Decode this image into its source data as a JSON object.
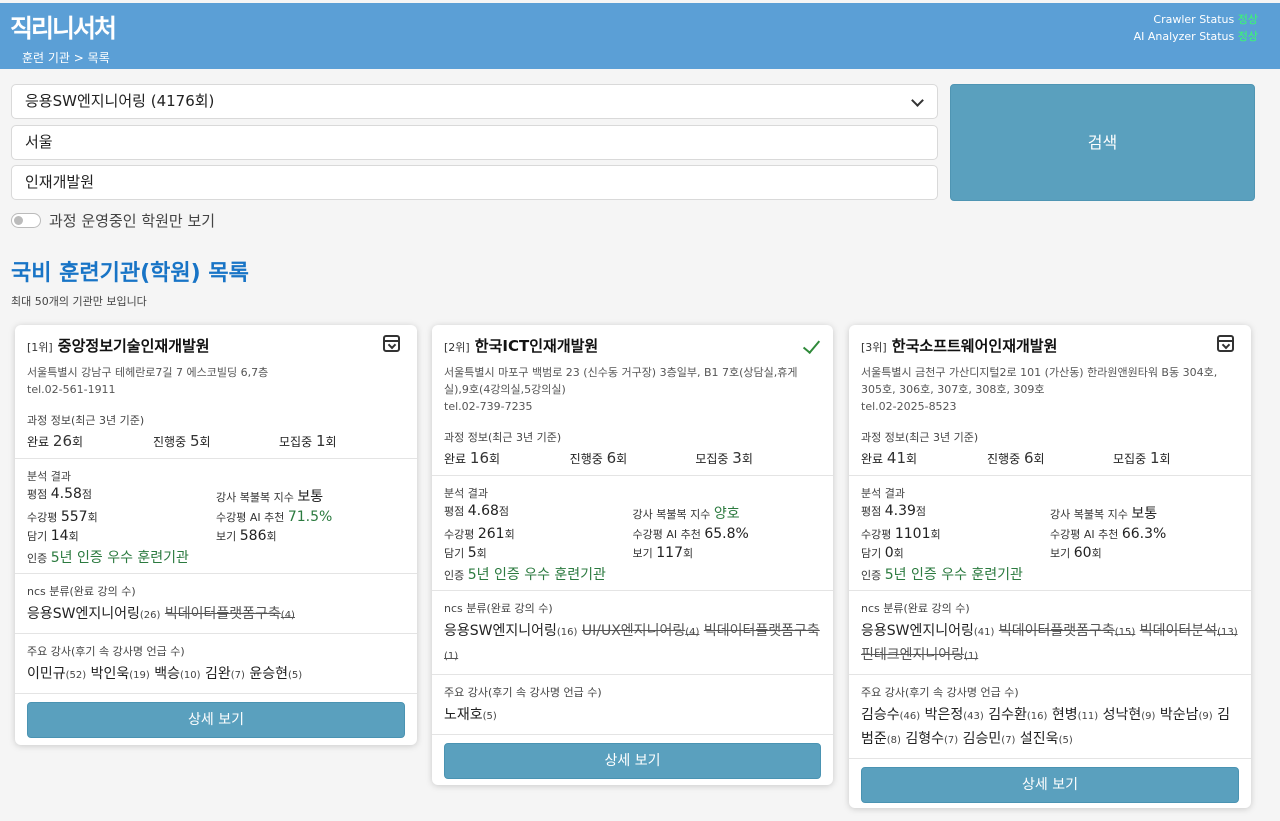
{
  "header": {
    "logo": "직리니서처",
    "breadcrumb": "훈련 기관 > 목록",
    "crawler_label": "Crawler Status",
    "crawler_value": "정상",
    "analyzer_label": "AI Analyzer Status",
    "analyzer_value": "정상"
  },
  "filters": {
    "course_select": "응용SW엔지니어링 (4176회)",
    "region": "서울",
    "keyword": "인재개발원",
    "search_label": "검색",
    "toggle_label": "과정 운영중인 학원만 보기"
  },
  "main": {
    "title": "국비 훈련기관(학원) 목록",
    "subtitle": "최대 50개의 기관만 보입니다"
  },
  "labels": {
    "course_info": "과정 정보(최근 3년 기준)",
    "done": "완료",
    "ongoing": "진행중",
    "recruit": "모집중",
    "unit_times": "회",
    "analysis": "분석 결과",
    "rating": "평점",
    "rating_unit": "점",
    "inst_index": "강사 복불복 지수",
    "attendance": "수강평",
    "ai_rec": "수강평 AI 추천",
    "like": "담기",
    "view": "보기",
    "cert": "인증",
    "ncs": "ncs 분류(완료 강의 수)",
    "teachers": "주요 강사(후기 속 강사명 언급 수)",
    "detail": "상세 보기"
  },
  "cards": [
    {
      "rank": "[1위]",
      "name": "중앙정보기술인재개발원",
      "address": "서울특별시 강남구 테헤란로7길 7 에스코빌딩 6,7층",
      "phone": "tel.02-561-1911",
      "done": "26",
      "ongoing": "5",
      "recruit": "1",
      "rating": "4.58",
      "inst_index": "보통",
      "attendance": "557",
      "ai_rec": "71.5%",
      "like": "14",
      "view": "586",
      "cert": "5년 인증 우수 훈련기관",
      "ncs": [
        {
          "name": "응용SW엔지니어링",
          "count": "(26)",
          "strike": false
        },
        {
          "name": "빅데이터플랫폼구축",
          "count": "(4)",
          "strike": true
        }
      ],
      "teachers": [
        {
          "name": "이민규",
          "count": "(52)"
        },
        {
          "name": "박인욱",
          "count": "(19)"
        },
        {
          "name": "백승",
          "count": "(10)"
        },
        {
          "name": "김완",
          "count": "(7)"
        },
        {
          "name": "윤승현",
          "count": "(5)"
        }
      ]
    },
    {
      "rank": "[2위]",
      "name": "한국ICT인재개발원",
      "address": "서울특별시 마포구 백범로 23 (신수동 거구장) 3층일부, B1 7호(상담실,휴게실),9호(4강의실,5강의실)",
      "phone": "tel.02-739-7235",
      "done": "16",
      "ongoing": "6",
      "recruit": "3",
      "rating": "4.68",
      "inst_index": "양호",
      "attendance": "261",
      "ai_rec": "65.8%",
      "like": "5",
      "view": "117",
      "cert": "5년 인증 우수 훈련기관",
      "ncs": [
        {
          "name": "응용SW엔지니어링",
          "count": "(16)",
          "strike": false
        },
        {
          "name": "UI/UX엔지니어링",
          "count": "(4)",
          "strike": true
        },
        {
          "name": "빅데이터플랫폼구축",
          "count": "(1)",
          "strike": true
        }
      ],
      "teachers": [
        {
          "name": "노재호",
          "count": "(5)"
        }
      ]
    },
    {
      "rank": "[3위]",
      "name": "한국소프트웨어인재개발원",
      "address": "서울특별시 금천구 가산디지털2로 101 (가산동) 한라원앤원타워 B동 304호, 305호, 306호, 307호, 308호, 309호",
      "phone": "tel.02-2025-8523",
      "done": "41",
      "ongoing": "6",
      "recruit": "1",
      "rating": "4.39",
      "inst_index": "보통",
      "attendance": "1101",
      "ai_rec": "66.3%",
      "like": "0",
      "view": "60",
      "cert": "5년 인증 우수 훈련기관",
      "ncs": [
        {
          "name": "응용SW엔지니어링",
          "count": "(41)",
          "strike": false
        },
        {
          "name": "빅데이터플랫폼구축",
          "count": "(15)",
          "strike": true
        },
        {
          "name": "빅데이터분석",
          "count": "(13)",
          "strike": true
        },
        {
          "name": "핀테크엔지니어링",
          "count": "(1)",
          "strike": true
        }
      ],
      "teachers": [
        {
          "name": "김승수",
          "count": "(46)"
        },
        {
          "name": "박은정",
          "count": "(43)"
        },
        {
          "name": "김수환",
          "count": "(16)"
        },
        {
          "name": "현병",
          "count": "(11)"
        },
        {
          "name": "성낙현",
          "count": "(9)"
        },
        {
          "name": "박순남",
          "count": "(9)"
        },
        {
          "name": "김범준",
          "count": "(8)"
        },
        {
          "name": "김형수",
          "count": "(7)"
        },
        {
          "name": "김승민",
          "count": "(7)"
        },
        {
          "name": "설진욱",
          "count": "(5)"
        }
      ]
    }
  ]
}
